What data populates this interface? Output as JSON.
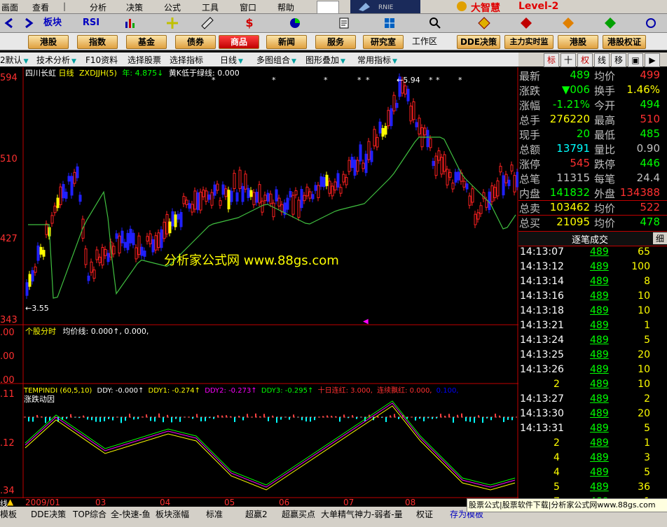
{
  "menu": [
    "画面",
    "查看",
    "分析",
    "决策",
    "公式",
    "工具",
    "窗口",
    "帮助"
  ],
  "brand": {
    "label": "大智慧",
    "edition": "Level-2"
  },
  "toolbar": {
    "items": [
      "板块",
      "RSI"
    ]
  },
  "categories": [
    "港股",
    "指数",
    "基金",
    "债券",
    "商品",
    "新闻",
    "服务",
    "研究室",
    "工作区",
    "DDE决策",
    "主力实时监",
    "港股",
    "港股权证"
  ],
  "functions": [
    "2默认",
    "技术分析",
    "F10资料",
    "选择股票",
    "选择指标",
    "日线",
    "多图组合",
    "图形叠加",
    "常用指标"
  ],
  "right_tabs": [
    "标",
    "十",
    "权",
    "线",
    "移",
    "▣",
    "▶"
  ],
  "chart": {
    "y_labels": [
      "594",
      "510",
      "427",
      "343"
    ],
    "legend_main": {
      "name": "四川长虹",
      "period": "日线",
      "indicator": "ZXDJJH(5)",
      "year": "年: 4.875↓",
      "note": "黄K低于绿线: 0.000"
    },
    "annot_low": "←3.55",
    "annot_high": "←5.94",
    "watermark": "分析家公式网 www.88gs.com",
    "sub1": {
      "name": "个股分时",
      "avg": "均价线: 0.000↑, 0.000,",
      "y_labels": [
        ".00",
        ".00",
        ".00"
      ]
    },
    "sub2": {
      "title": "TEMPINDI",
      "params": "(60,5,10)",
      "dde": "DDY: -0.000↑",
      "ddy1": "DDY1: -0.274↑",
      "ddy2": "DDY2: -0.273↑",
      "ddy3": "DDY3: -0.295↑",
      "shirilh": "十日连红: 3.000,",
      "lxph": "连续飘红: 0.000,",
      "hundred": "0.100,",
      "label2": "涨跌动因",
      "y_labels": [
        ".11",
        ".12",
        ".34"
      ]
    },
    "x_labels": [
      "2009/01",
      "03",
      "04",
      "05",
      "06",
      "07",
      "08"
    ]
  },
  "quote": [
    {
      "l": "最新",
      "v": "489",
      "vc": "#00ff00",
      "l2": "均价",
      "v2": "499",
      "v2c": "#ff3030"
    },
    {
      "l": "涨跌",
      "v": "▼006",
      "vc": "#00ff00",
      "l2": "换手",
      "v2": "1.46%",
      "v2c": "#ffff00"
    },
    {
      "l": "涨幅",
      "v": "-1.21%",
      "vc": "#00ff00",
      "l2": "今开",
      "v2": "494",
      "v2c": "#00ff00"
    },
    {
      "l": "总手",
      "v": "276220",
      "vc": "#ffff00",
      "l2": "最高",
      "v2": "510",
      "v2c": "#ff3030"
    },
    {
      "l": "现手",
      "v": "20",
      "vc": "#00ff00",
      "l2": "最低",
      "v2": "485",
      "v2c": "#00ff00"
    },
    {
      "l": "总额",
      "v": "13791",
      "vc": "#00ffff",
      "l2": "量比",
      "v2": "0.90",
      "v2c": "#c0c0c0"
    },
    {
      "l": "涨停",
      "v": "545",
      "vc": "#ff3030",
      "l2": "跌停",
      "v2": "446",
      "v2c": "#00ff00"
    },
    {
      "l": "总笔",
      "v": "11315",
      "vc": "#c0c0c0",
      "l2": "每笔",
      "v2": "24.4",
      "v2c": "#c0c0c0"
    },
    {
      "l": "内盘",
      "v": "141832",
      "vc": "#00ff00",
      "l2": "外盘",
      "v2": "134388",
      "v2c": "#ff3030"
    },
    {
      "l": "总卖",
      "v": "103462",
      "vc": "#ffff00",
      "l2": "均价",
      "v2": "522",
      "v2c": "#ff3030"
    },
    {
      "l": "总买",
      "v": "21095",
      "vc": "#ffff00",
      "l2": "均价",
      "v2": "478",
      "v2c": "#00ff00"
    }
  ],
  "ticks_header": {
    "title": "逐笔成交",
    "tab": "细"
  },
  "ticks": [
    {
      "t": "14:13:07",
      "p": "489",
      "v": "65"
    },
    {
      "t": "14:13:12",
      "p": "489",
      "v": "100"
    },
    {
      "t": "14:13:14",
      "p": "489",
      "v": "8"
    },
    {
      "t": "14:13:16",
      "p": "489",
      "v": "10"
    },
    {
      "t": "14:13:18",
      "p": "489",
      "v": "10"
    },
    {
      "t": "14:13:21",
      "p": "489",
      "v": "1"
    },
    {
      "t": "14:13:24",
      "p": "489",
      "v": "5"
    },
    {
      "t": "14:13:25",
      "p": "489",
      "v": "20"
    },
    {
      "t": "14:13:26",
      "p": "489",
      "v": "10"
    },
    {
      "t": "2",
      "p": "489",
      "v": "10"
    },
    {
      "t": "14:13:27",
      "p": "489",
      "v": "2"
    },
    {
      "t": "14:13:30",
      "p": "489",
      "v": "20"
    },
    {
      "t": "14:13:31",
      "p": "489",
      "v": "5"
    },
    {
      "t": "2",
      "p": "489",
      "v": "1"
    },
    {
      "t": "4",
      "p": "489",
      "v": "3"
    },
    {
      "t": "4",
      "p": "489",
      "v": "5"
    },
    {
      "t": "5",
      "p": "489",
      "v": "36"
    },
    {
      "t": "7",
      "p": "489",
      "v": "1"
    }
  ],
  "bottom_tabs": [
    "模板",
    "DDE决策",
    "TOP综合",
    "全-快速-鱼",
    "板块涨幅",
    "标准",
    "超赢2",
    "超赢买点",
    "大单精气神力-弱者-量",
    "权证",
    "存为模板"
  ],
  "footer_ad": "股票公式|股票软件下载|分析家公式网www.88gs.com"
}
